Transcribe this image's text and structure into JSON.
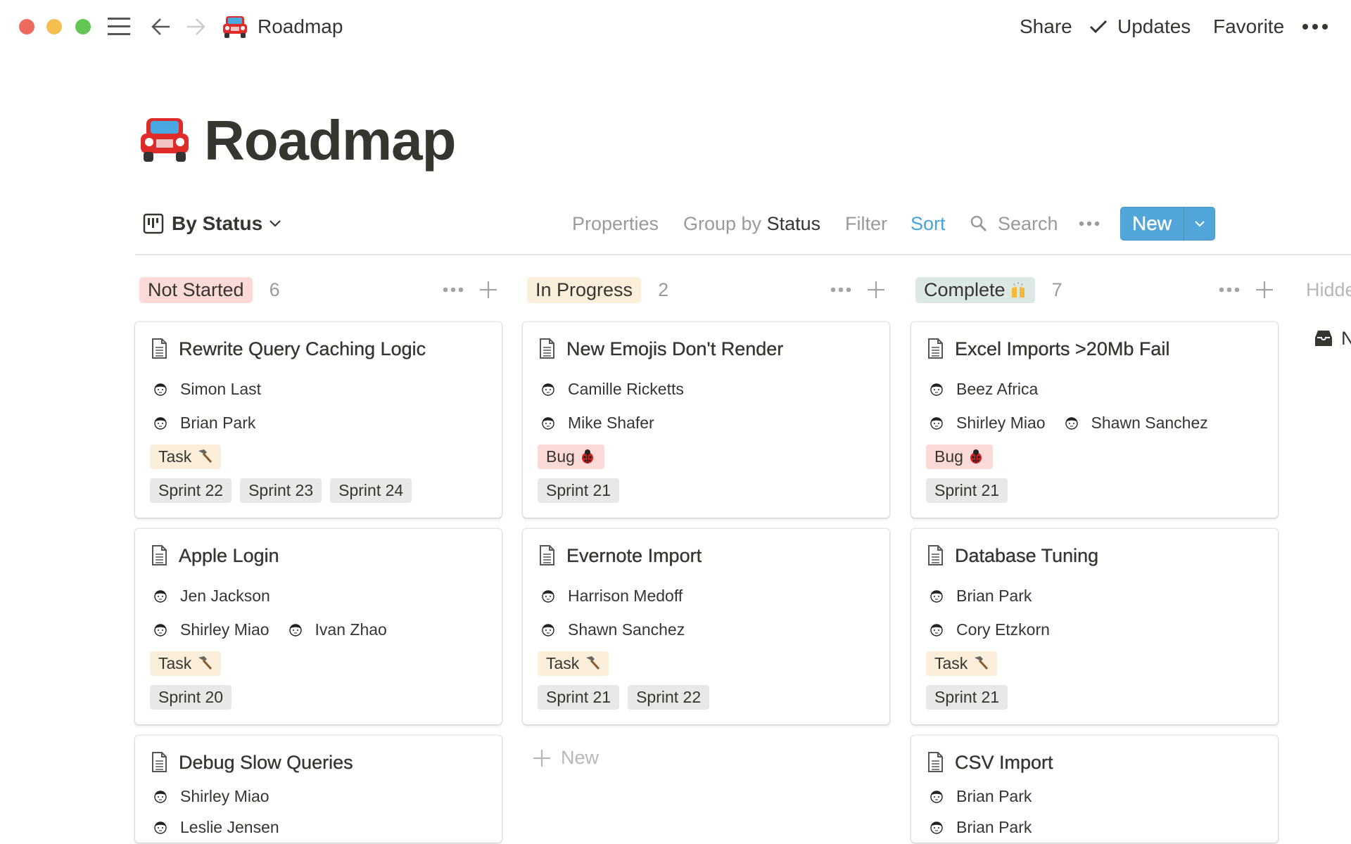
{
  "topbar": {
    "title": "Roadmap",
    "share": "Share",
    "updates": "Updates",
    "favorite": "Favorite",
    "icons": [
      "close-dot",
      "minimize-dot",
      "zoom-dot",
      "menu-icon",
      "back-arrow-icon",
      "forward-arrow-icon",
      "car-icon",
      "check-icon",
      "more-icon"
    ]
  },
  "page": {
    "title": "Roadmap",
    "icon": "car-icon"
  },
  "viewbar": {
    "view_name": "By Status",
    "properties": "Properties",
    "group_by_prefix": "Group by",
    "group_by_value": "Status",
    "filter": "Filter",
    "sort": "Sort",
    "search": "Search",
    "new_label": "New"
  },
  "colors": {
    "text": "#37352f",
    "gray": "#9b9a97",
    "accent": "#46a3d9",
    "new_button": "#52a5d8"
  },
  "hidden_label": "Hidden",
  "hidden_item": "N",
  "add_new_label": "New",
  "groups": [
    {
      "label": "Not Started",
      "count": "6",
      "color": "#fbdad7",
      "emoji": "",
      "cards": [
        {
          "title": "Rewrite Query Caching Logic",
          "people": [
            [
              "Simon Last"
            ],
            [
              "Brian Park"
            ]
          ],
          "type": {
            "label": "Task",
            "icon": "hammer",
            "color": "#fbeedb"
          },
          "sprints": [
            "Sprint 22",
            "Sprint 23",
            "Sprint 24"
          ]
        },
        {
          "title": "Apple Login",
          "people": [
            [
              "Jen Jackson"
            ],
            [
              "Shirley Miao",
              "Ivan Zhao"
            ]
          ],
          "type": {
            "label": "Task",
            "icon": "hammer",
            "color": "#fbeedb"
          },
          "sprints": [
            "Sprint 20"
          ]
        },
        {
          "title": "Debug Slow Queries",
          "people": [
            [
              "Shirley Miao"
            ],
            [
              "Leslie Jensen"
            ]
          ],
          "type": null,
          "sprints": []
        }
      ]
    },
    {
      "label": "In Progress",
      "count": "2",
      "color": "#fbeedb",
      "emoji": "",
      "cards": [
        {
          "title": "New Emojis Don't Render",
          "people": [
            [
              "Camille Ricketts"
            ],
            [
              "Mike Shafer"
            ]
          ],
          "type": {
            "label": "Bug",
            "icon": "ladybug",
            "color": "#fbdad7"
          },
          "sprints": [
            "Sprint 21"
          ]
        },
        {
          "title": "Evernote Import",
          "people": [
            [
              "Harrison Medoff"
            ],
            [
              "Shawn Sanchez"
            ]
          ],
          "type": {
            "label": "Task",
            "icon": "hammer",
            "color": "#fbeedb"
          },
          "sprints": [
            "Sprint 21",
            "Sprint 22"
          ]
        }
      ]
    },
    {
      "label": "Complete",
      "count": "7",
      "color": "#dbe8e3",
      "emoji": "raised-hands",
      "cards": [
        {
          "title": "Excel Imports >20Mb Fail",
          "people": [
            [
              "Beez Africa"
            ],
            [
              "Shirley Miao",
              "Shawn Sanchez"
            ]
          ],
          "type": {
            "label": "Bug",
            "icon": "ladybug",
            "color": "#fbdad7"
          },
          "sprints": [
            "Sprint 21"
          ]
        },
        {
          "title": "Database Tuning",
          "people": [
            [
              "Brian Park"
            ],
            [
              "Cory Etzkorn"
            ]
          ],
          "type": {
            "label": "Task",
            "icon": "hammer",
            "color": "#fbeedb"
          },
          "sprints": [
            "Sprint 21"
          ]
        },
        {
          "title": "CSV Import",
          "people": [
            [
              "Brian Park"
            ],
            [
              "Brian Park"
            ]
          ],
          "type": null,
          "sprints": []
        }
      ]
    }
  ]
}
